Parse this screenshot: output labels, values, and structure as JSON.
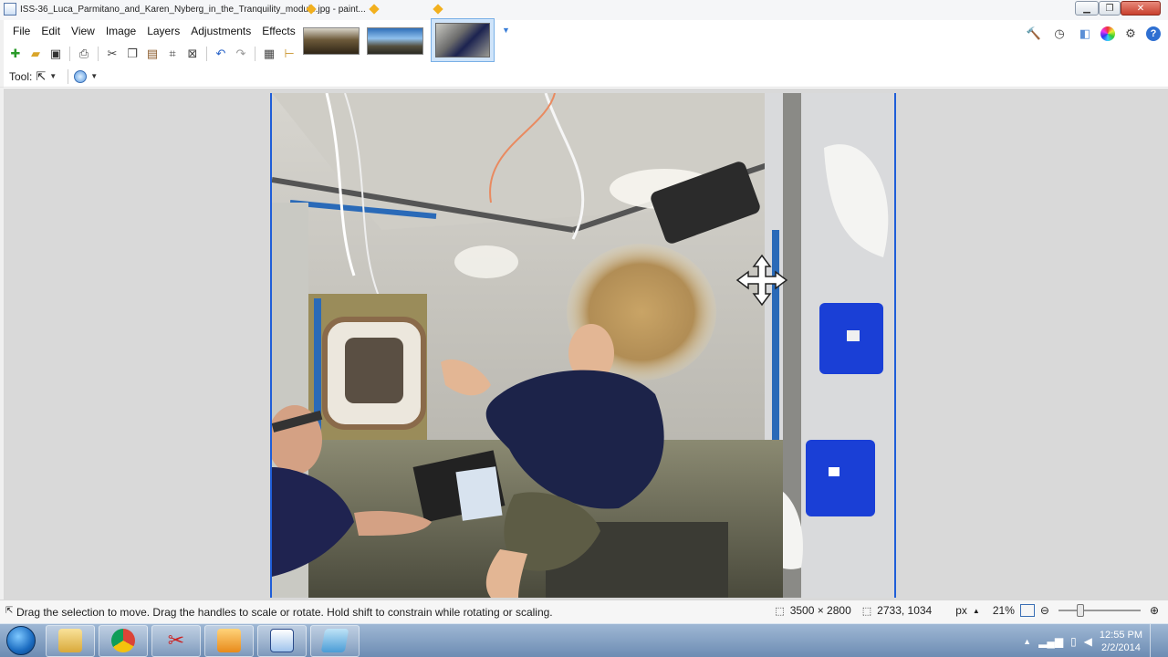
{
  "window": {
    "title": "ISS-36_Luca_Parmitano_and_Karen_Nyberg_in_the_Tranquility_module.jpg - paint..."
  },
  "menu": {
    "items": [
      "File",
      "Edit",
      "View",
      "Image",
      "Layers",
      "Adjustments",
      "Effects"
    ]
  },
  "toolbar": {
    "tool_label": "Tool:"
  },
  "status": {
    "message": "Drag the selection to move. Drag the handles to scale or rotate. Hold shift to constrain while rotating or scaling.",
    "image_size": "3500 × 2800",
    "cursor_position": "2733, 1034",
    "units": "px",
    "zoom": "21%"
  },
  "taskbar": {
    "clock_time": "12:55 PM",
    "clock_date": "2/2/2014"
  },
  "colors": {
    "selection_border": "#1f5ed8",
    "canvas_bg": "#d9d9d9"
  }
}
